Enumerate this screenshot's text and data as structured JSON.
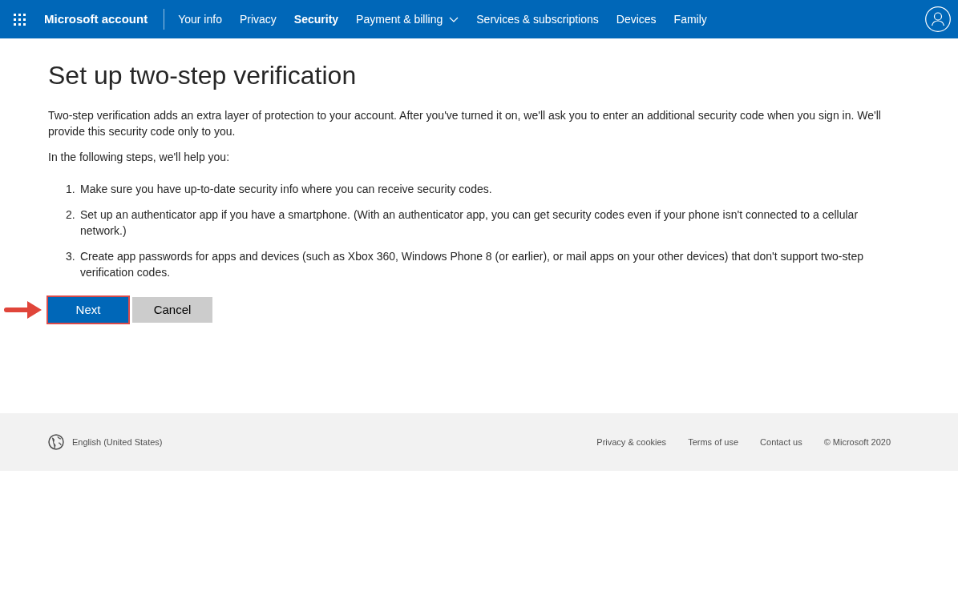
{
  "nav": {
    "brand": "Microsoft account",
    "items": [
      {
        "label": "Your info",
        "selected": false,
        "dropdown": false
      },
      {
        "label": "Privacy",
        "selected": false,
        "dropdown": false
      },
      {
        "label": "Security",
        "selected": true,
        "dropdown": false
      },
      {
        "label": "Payment & billing",
        "selected": false,
        "dropdown": true
      },
      {
        "label": "Services & subscriptions",
        "selected": false,
        "dropdown": false
      },
      {
        "label": "Devices",
        "selected": false,
        "dropdown": false
      },
      {
        "label": "Family",
        "selected": false,
        "dropdown": false
      }
    ]
  },
  "title": "Set up two-step verification",
  "intro": "Two-step verification adds an extra layer of protection to your account. After you've turned it on, we'll ask you to enter an additional security code when you sign in. We'll provide this security code only to you.",
  "lead": "In the following steps, we'll help you:",
  "steps": [
    {
      "number": "1.",
      "text": "Make sure you have up-to-date security info where you can receive security codes."
    },
    {
      "number": "2.",
      "text": "Set up an authenticator app if you have a smartphone. (With an authenticator app, you can get security codes even if your phone isn't connected to a cellular network.)"
    },
    {
      "number": "3.",
      "text": "Create app passwords for apps and devices (such as Xbox 360, Windows Phone 8 (or earlier), or mail apps on your other devices) that don't support two-step verification codes."
    }
  ],
  "buttons": [
    {
      "label": "Next",
      "kind": "primary",
      "highlighted": true
    },
    {
      "label": "Cancel",
      "kind": "secondary",
      "highlighted": false
    }
  ],
  "footer": {
    "language": "English (United States)",
    "links": [
      "Privacy & cookies",
      "Terms of use",
      "Contact us"
    ],
    "copyright": "© Microsoft 2020"
  }
}
